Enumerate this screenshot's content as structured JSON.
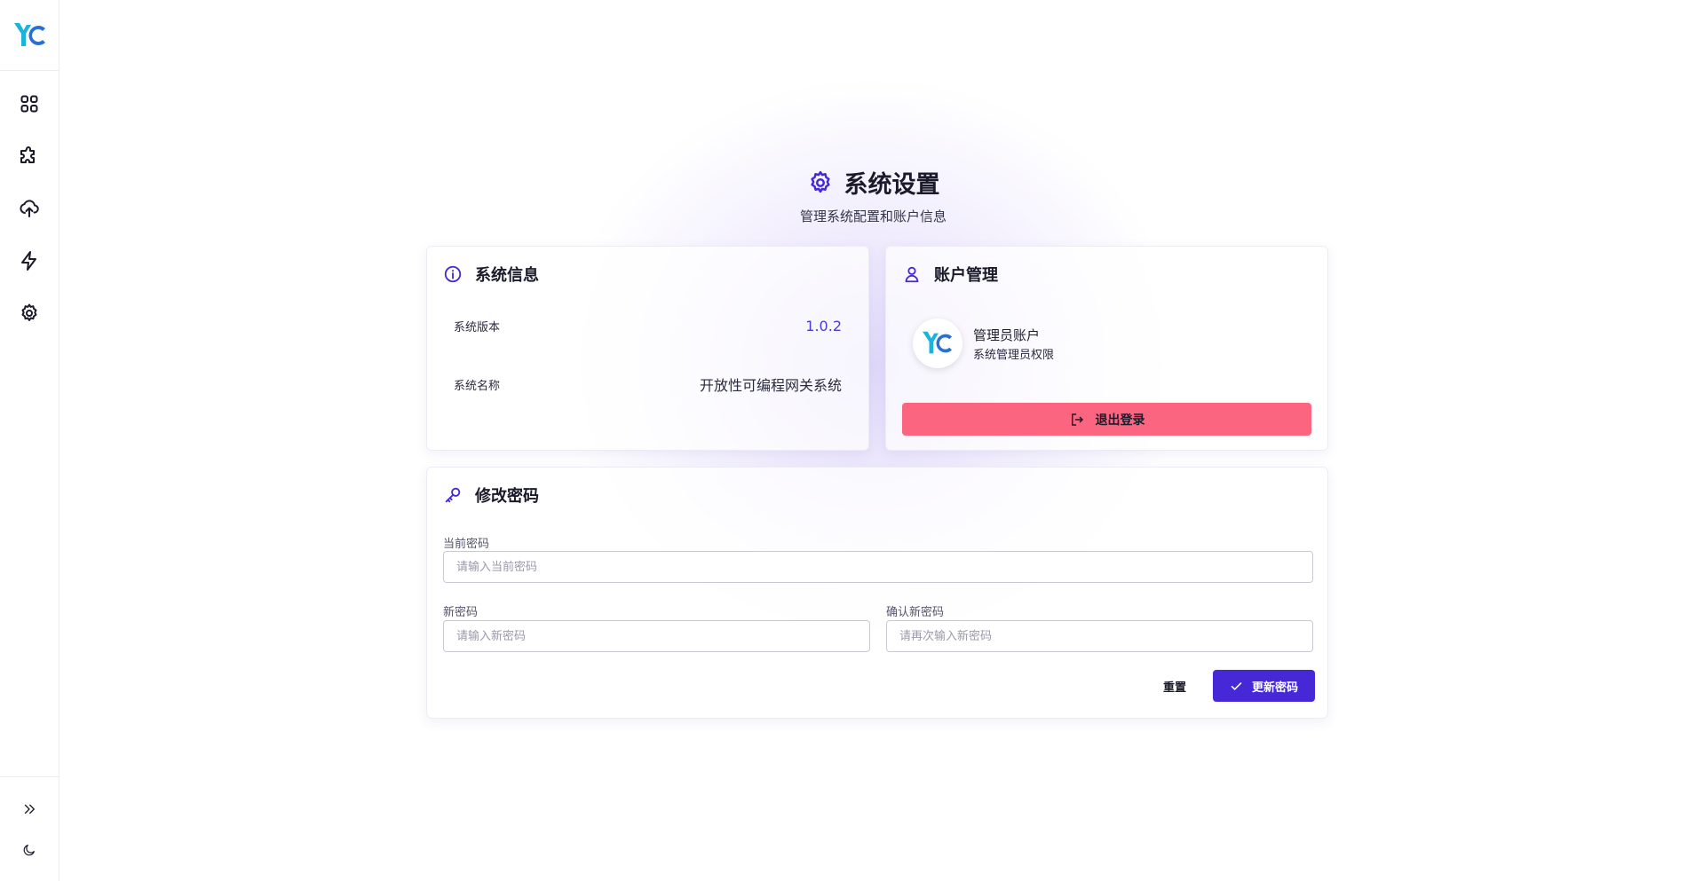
{
  "sidebar": {
    "logo": "YC",
    "nav": [
      {
        "icon": "dashboard-grid-icon"
      },
      {
        "icon": "puzzle-icon"
      },
      {
        "icon": "cloud-upload-icon"
      },
      {
        "icon": "lightning-icon"
      },
      {
        "icon": "gear-icon"
      }
    ],
    "bottom": [
      {
        "icon": "chevrons-right-icon"
      },
      {
        "icon": "moon-icon"
      }
    ]
  },
  "header": {
    "title": "系统设置",
    "subtitle": "管理系统配置和账户信息"
  },
  "system_info": {
    "title": "系统信息",
    "rows": [
      {
        "label": "系统版本",
        "value": "1.0.2"
      },
      {
        "label": "系统名称",
        "value": "开放性可编程网关系统"
      }
    ]
  },
  "account": {
    "title": "账户管理",
    "name": "管理员账户",
    "role": "系统管理员权限",
    "logout_label": "退出登录"
  },
  "password": {
    "title": "修改密码",
    "current_label": "当前密码",
    "current_placeholder": "请输入当前密码",
    "new_label": "新密码",
    "new_placeholder": "请输入新密码",
    "confirm_label": "确认新密码",
    "confirm_placeholder": "请再次输入新密码",
    "reset_label": "重置",
    "submit_label": "更新密码"
  },
  "colors": {
    "accent": "#4628d6",
    "danger": "#fb6580",
    "logo_cyan": "#1ab3dc",
    "logo_blue": "#2a6fd6"
  }
}
